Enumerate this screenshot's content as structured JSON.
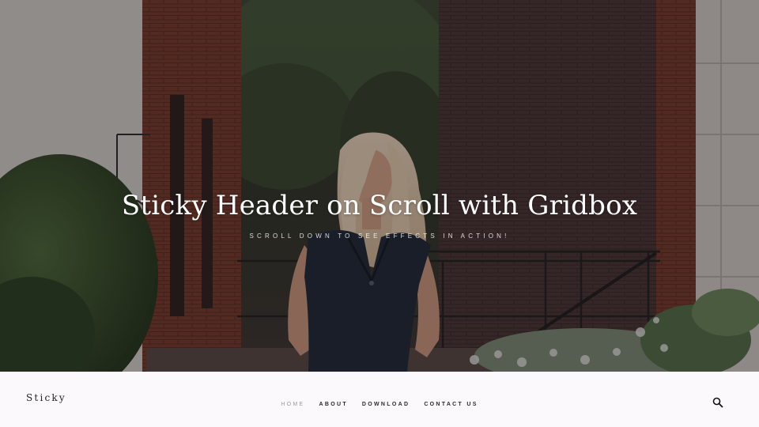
{
  "hero": {
    "title": "Sticky Header on Scroll with Gridbox",
    "subtitle": "SCROLL DOWN TO SEE EFFECTS IN ACTION!",
    "overlay_color": "#141012"
  },
  "header": {
    "logo": "Sticky",
    "nav": [
      {
        "label": "HOME",
        "active": true
      },
      {
        "label": "ABOUT",
        "active": false
      },
      {
        "label": "DOWNLOAD",
        "active": false
      },
      {
        "label": "CONTACT US",
        "active": false
      }
    ],
    "search_icon": "search-icon",
    "background": "#fbf9fb"
  }
}
